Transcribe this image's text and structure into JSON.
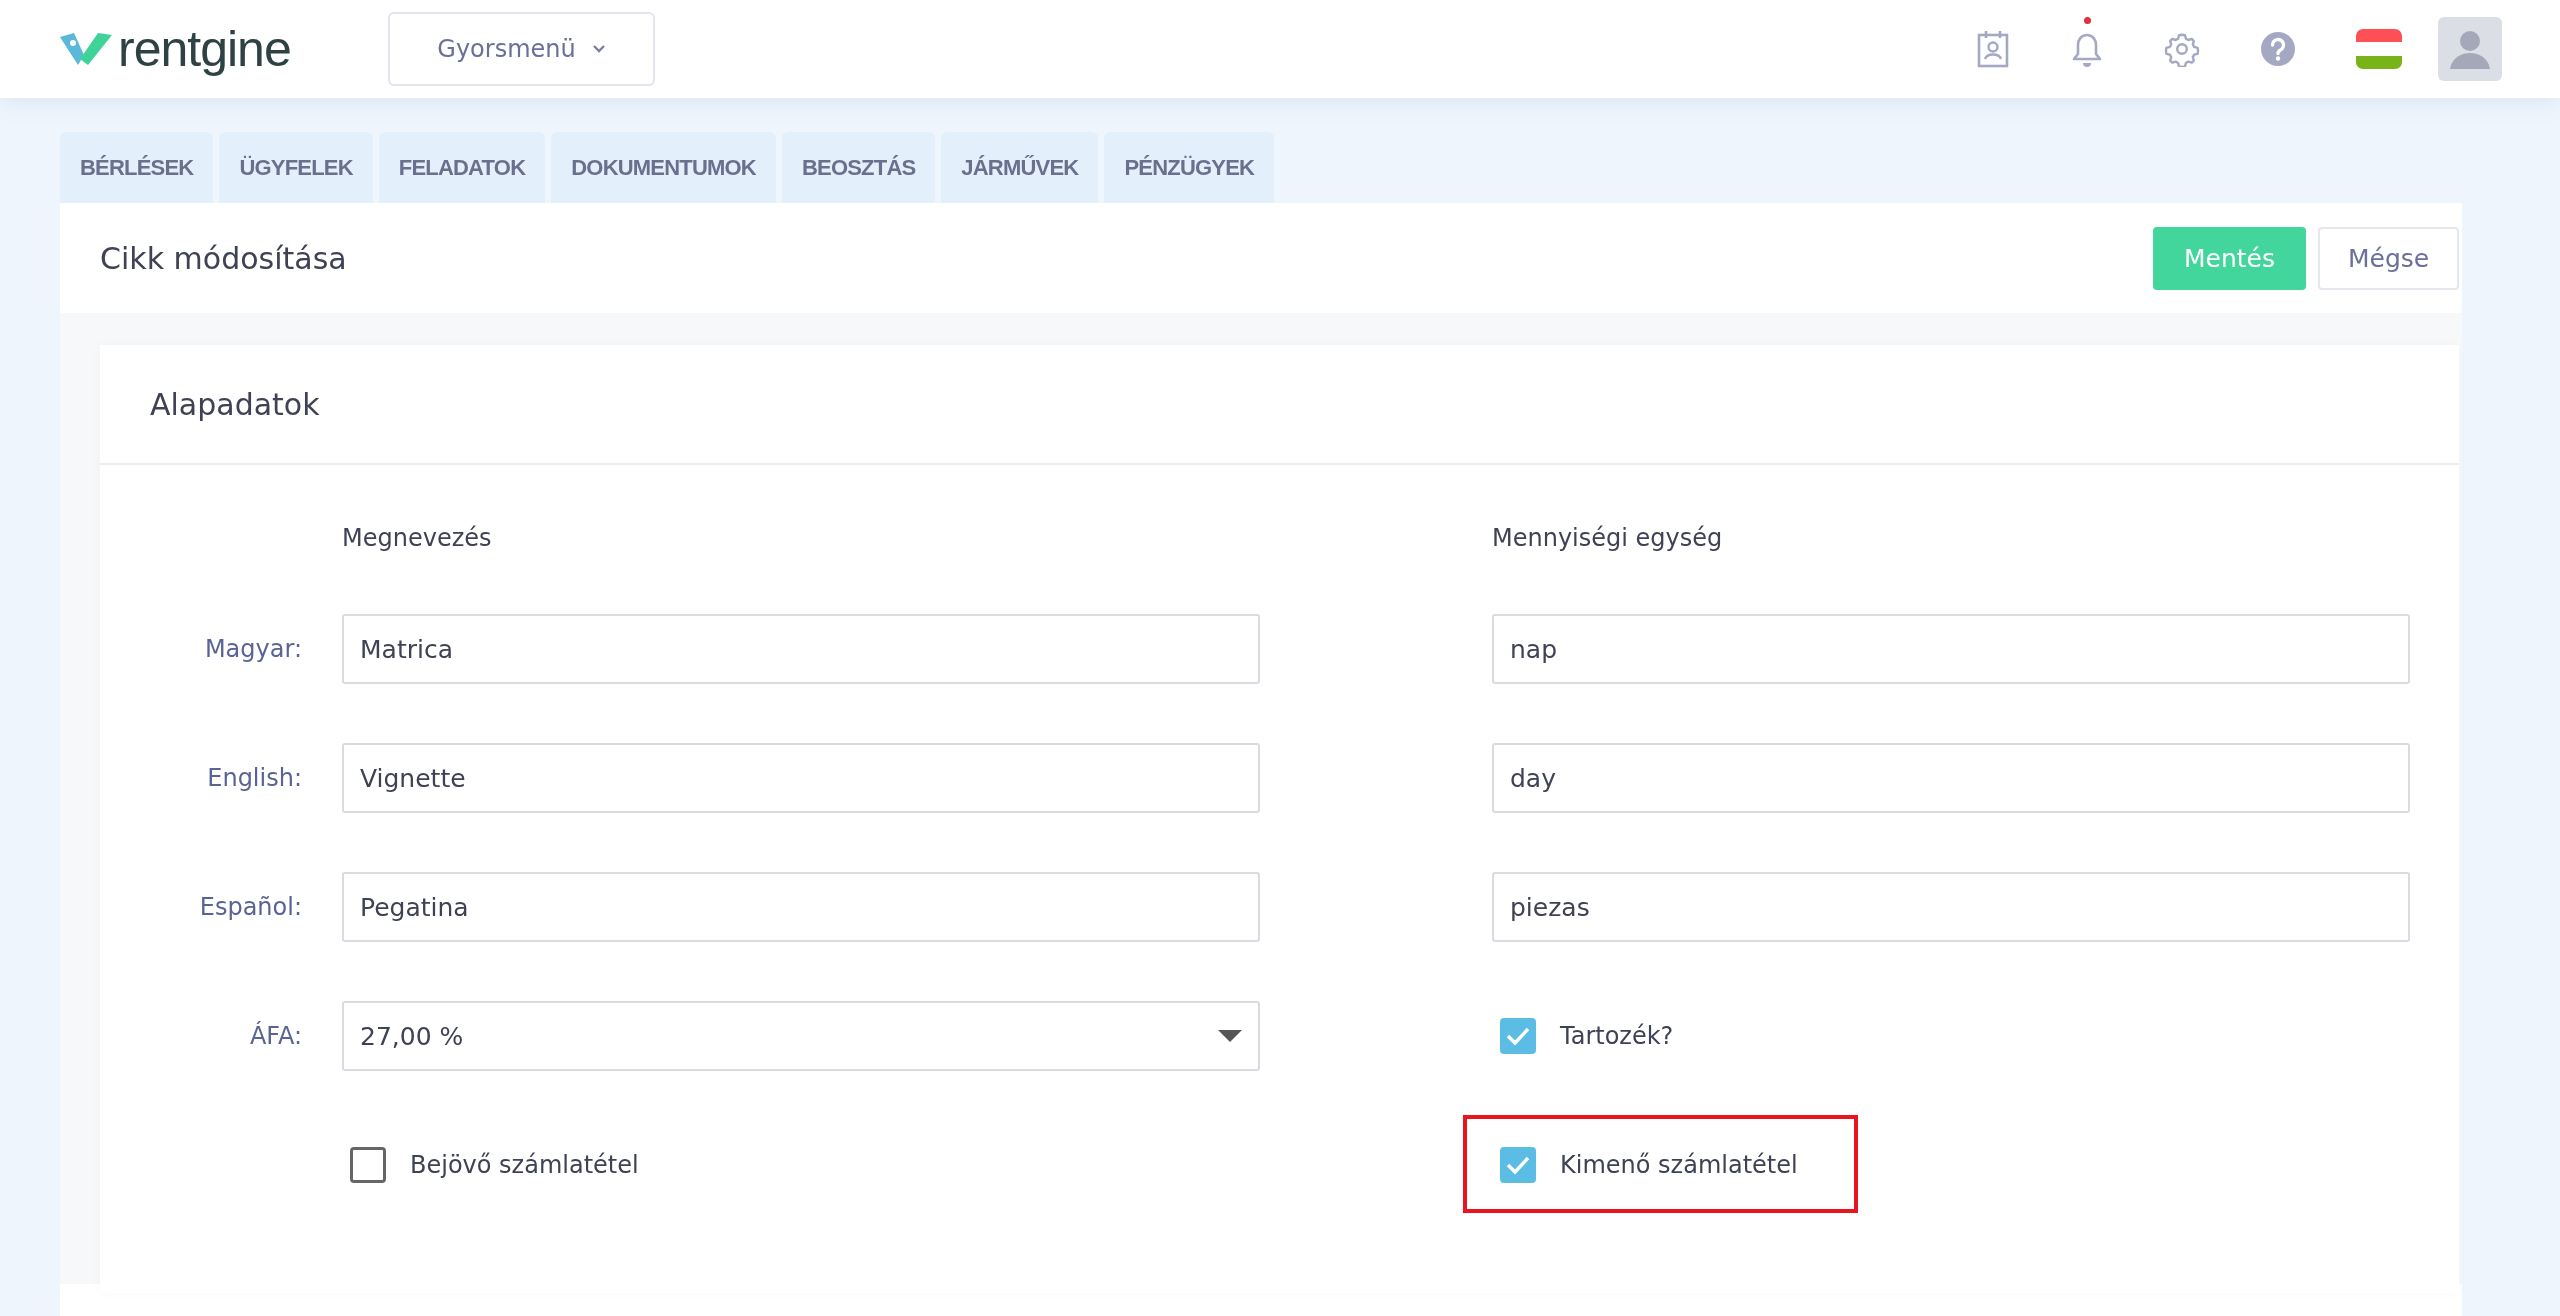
{
  "header": {
    "logo_text": "rentgine",
    "quick_menu": "Gyorsmenü",
    "notification_dot": true
  },
  "tabs": [
    {
      "label": "BÉRLÉSEK",
      "selected": false
    },
    {
      "label": "ÜGYFELEK",
      "selected": false
    },
    {
      "label": "FELADATOK",
      "selected": false
    },
    {
      "label": "DOKUMENTUMOK",
      "selected": false
    },
    {
      "label": "BEOSZTÁS",
      "selected": false
    },
    {
      "label": "JÁRMŰVEK",
      "selected": false
    },
    {
      "label": "PÉNZÜGYEK",
      "selected": false
    }
  ],
  "page": {
    "title": "Cikk módosítása",
    "buttons": [
      {
        "label": "Mentés",
        "kind": "primary"
      },
      {
        "label": "Mégse",
        "kind": "secondary"
      }
    ]
  },
  "section": {
    "title": "Alapadatok",
    "name_heading": "Megnevezés",
    "unit_heading": "Mennyiségi egység",
    "rows": [
      {
        "label": "Magyar:",
        "name": "Matrica",
        "unit": "nap"
      },
      {
        "label": "English:",
        "name": "Vignette",
        "unit": "day"
      },
      {
        "label": "Español:",
        "name": "Pegatina",
        "unit": "piezas"
      }
    ],
    "vat": {
      "label": "ÁFA:",
      "value": "27,00 %"
    },
    "accessory": {
      "label": "Tartozék?",
      "checked": true
    },
    "incoming": {
      "label": "Bejövő számlatétel",
      "checked": false
    },
    "outgoing": {
      "label": "Kimenő számlatétel",
      "checked": true,
      "highlighted": true
    }
  }
}
